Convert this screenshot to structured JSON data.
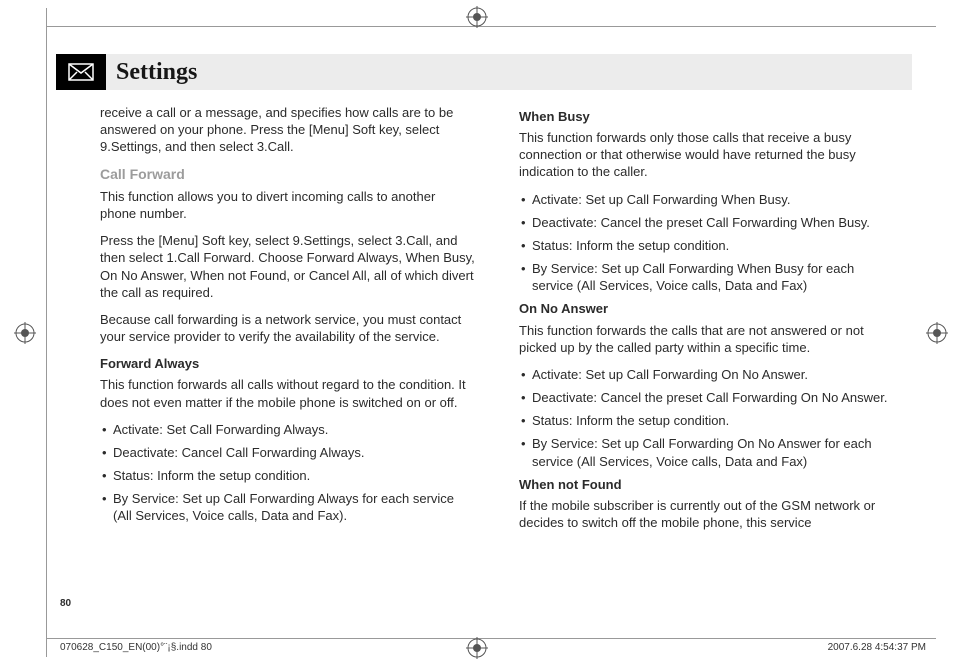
{
  "header": {
    "title": "Settings"
  },
  "left": {
    "intro": "receive a call or a message, and specifies how calls are to be answered on your phone. Press the [Menu] Soft key, select 9.Settings, and then select 3.Call.",
    "sec_call_forward": "Call Forward",
    "cf1": "This function allows you to divert incoming calls to another phone number.",
    "cf2": "Press the [Menu] Soft key, select 9.Settings, select 3.Call, and then select 1.Call Forward. Choose Forward Always, When Busy, On No Answer, When not Found, or Cancel All, all of which divert the call as required.",
    "cf3": "Because call forwarding is a network service, you must contact your service provider to verify the availability of the service.",
    "fa_head": "Forward Always",
    "fa_desc": "This function forwards all calls without regard to the condition. It does not even matter if the mobile phone is switched on or off.",
    "fa_li1": "Activate: Set Call Forwarding Always.",
    "fa_li2": "Deactivate: Cancel Call Forwarding Always.",
    "fa_li3": "Status: Inform the setup condition.",
    "fa_li4": "By Service: Set up Call Forwarding Always for each service (All Services, Voice calls, Data and Fax)."
  },
  "right": {
    "wb_head": "When Busy",
    "wb_desc": "This function forwards only those calls that receive a busy connection or that otherwise would have returned the busy indication to the caller.",
    "wb_li1": "Activate: Set up Call Forwarding When Busy.",
    "wb_li2": "Deactivate: Cancel the preset Call Forwarding When Busy.",
    "wb_li3": "Status: Inform the setup condition.",
    "wb_li4": "By Service: Set up Call Forwarding When Busy for each service (All Services, Voice calls, Data and Fax)",
    "ona_head": "On No Answer",
    "ona_desc": "This function forwards the calls that are not answered or not picked up by the called party within a specific time.",
    "ona_li1": "Activate: Set up Call Forwarding On No Answer.",
    "ona_li2": "Deactivate: Cancel the preset Call Forwarding On No Answer.",
    "ona_li3": "Status: Inform the setup condition.",
    "ona_li4": "By Service: Set up Call Forwarding On No Answer for each service (All Services, Voice calls, Data and Fax)",
    "wnf_head": "When not Found",
    "wnf_desc": "If the mobile subscriber is currently out of the GSM network or decides to switch off the mobile phone, this service"
  },
  "page_number": "80",
  "footer_left": "070628_C150_EN(00)°¨¡§.indd   80",
  "footer_right": "2007.6.28   4:54:37 PM"
}
